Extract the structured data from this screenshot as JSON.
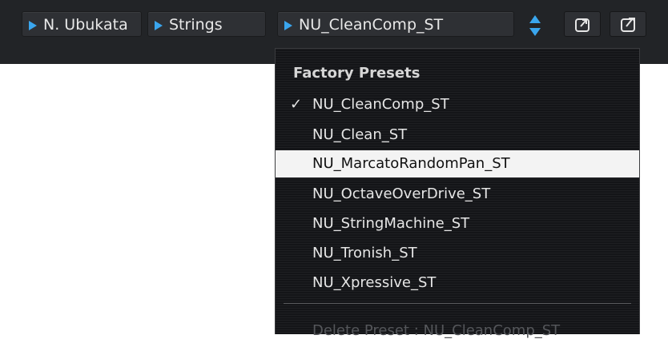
{
  "toolbar": {
    "author": "N. Ubukata",
    "category": "Strings",
    "preset": "NU_CleanComp_ST",
    "accent_color": "#3aa6ee",
    "icons": [
      "triangle-right-icon",
      "up-down-arrows-icon",
      "load-preset-icon",
      "save-preset-icon"
    ]
  },
  "menu": {
    "header": "Factory Presets",
    "items": [
      {
        "label": "NU_CleanComp_ST",
        "checked": true
      },
      {
        "label": "NU_Clean_ST"
      },
      {
        "label": "NU_MarcatoRandomPan_ST",
        "highlighted": true
      },
      {
        "label": "NU_OctaveOverDrive_ST"
      },
      {
        "label": "NU_StringMachine_ST"
      },
      {
        "label": "NU_Tronish_ST"
      },
      {
        "label": "NU_Xpressive_ST"
      }
    ],
    "check_glyph": "✓",
    "delete_label": "Delete Preset : NU_CleanComp_ST"
  }
}
